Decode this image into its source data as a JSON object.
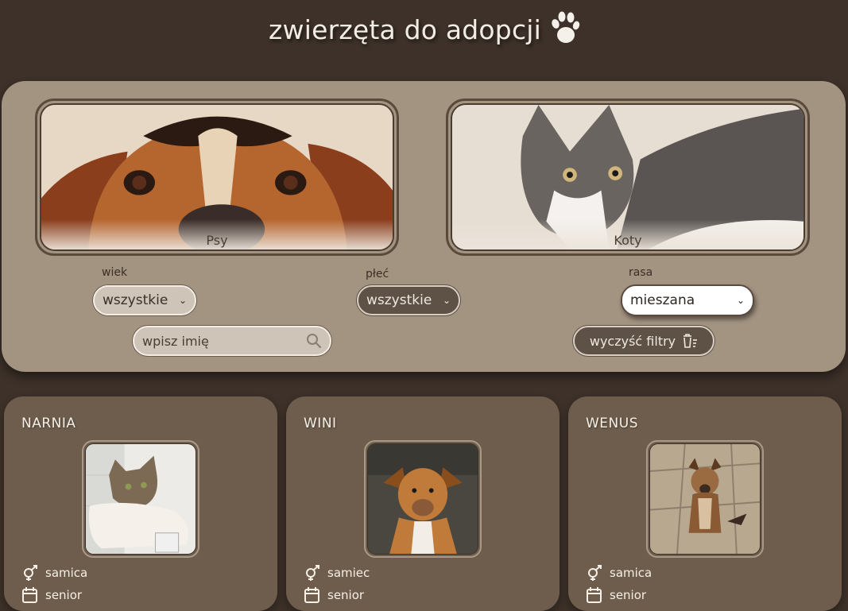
{
  "header": {
    "title": "zwierzęta do adopcji",
    "logo_icon": "paw-icon"
  },
  "species": {
    "dogs_label": "Psy",
    "cats_label": "Koty"
  },
  "filters": {
    "age_label": "wiek",
    "age_value": "wszystkie",
    "sex_label": "płeć",
    "sex_value": "wszystkie",
    "breed_label": "rasa",
    "breed_value": "mieszana",
    "search_placeholder": "wpisz imię",
    "clear_label": "wyczyść filtry"
  },
  "animals": [
    {
      "name": "NARNIA",
      "sex": "samica",
      "age": "senior",
      "photo": "cat-photo"
    },
    {
      "name": "WINI",
      "sex": "samiec",
      "age": "senior",
      "photo": "dog-photo"
    },
    {
      "name": "WENUS",
      "sex": "samica",
      "age": "senior",
      "photo": "dog-photo"
    }
  ],
  "colors": {
    "background": "#3d3129",
    "panel": "#a39381",
    "card": "#6e5d4c",
    "text_light": "#f5efe7"
  }
}
